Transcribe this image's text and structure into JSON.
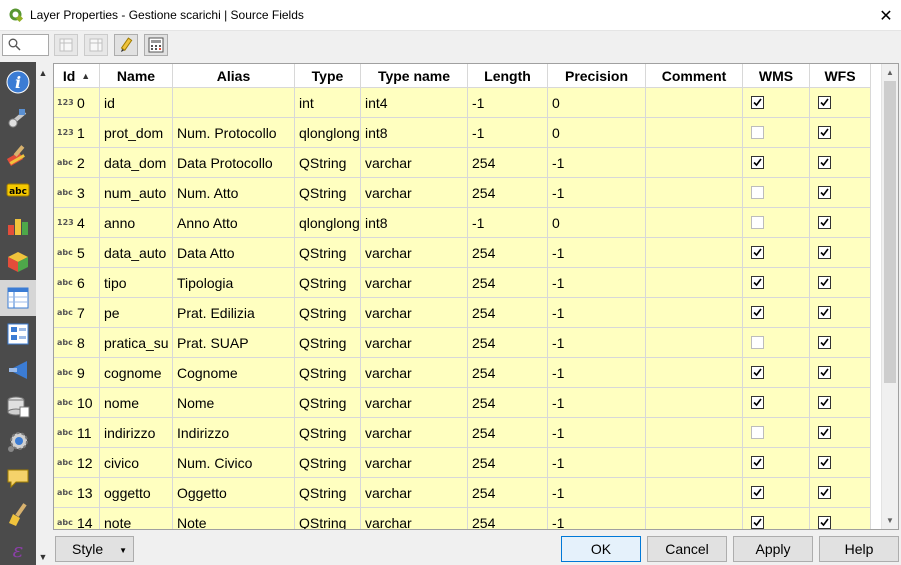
{
  "window": {
    "title": "Layer Properties - Gestione scarichi | Source Fields",
    "close_glyph": "✕"
  },
  "left_panel": {
    "search_placeholder": "",
    "nav_icons": [
      "information-icon",
      "source-icon",
      "style-icon",
      "labels-icon",
      "diagrams-icon",
      "3d-view-icon",
      "source-fields-icon",
      "attributes-form-icon",
      "joins-icon",
      "auxiliary-storage-icon",
      "actions-icon",
      "display-icon",
      "rendering-icon",
      "variables-icon"
    ],
    "active_item": "source-fields-icon"
  },
  "toolbar": {
    "buttons": [
      "new-field-icon",
      "delete-field-icon",
      "toggle-editing-icon",
      "field-calculator-icon"
    ]
  },
  "table": {
    "columns": [
      "Id",
      "Name",
      "Alias",
      "Type",
      "Type name",
      "Length",
      "Precision",
      "Comment",
      "WMS",
      "WFS"
    ],
    "sort_column": "Id",
    "sort_indicator": "▲",
    "rows": [
      {
        "type_icon": "123",
        "id": "0",
        "name": "id",
        "alias": "",
        "type": "int",
        "type_name": "int4",
        "length": "-1",
        "precision": "0",
        "comment": "",
        "wms": true,
        "wfs": true
      },
      {
        "type_icon": "123",
        "id": "1",
        "name": "prot_dom",
        "alias": "Num. Protocollo",
        "type": "qlonglong",
        "type_name": "int8",
        "length": "-1",
        "precision": "0",
        "comment": "",
        "wms": false,
        "wfs": true
      },
      {
        "type_icon": "abc",
        "id": "2",
        "name": "data_dom",
        "alias": "Data Protocollo",
        "type": "QString",
        "type_name": "varchar",
        "length": "254",
        "precision": "-1",
        "comment": "",
        "wms": true,
        "wfs": true
      },
      {
        "type_icon": "abc",
        "id": "3",
        "name": "num_auto",
        "alias": "Num. Atto",
        "type": "QString",
        "type_name": "varchar",
        "length": "254",
        "precision": "-1",
        "comment": "",
        "wms": false,
        "wfs": true
      },
      {
        "type_icon": "123",
        "id": "4",
        "name": "anno",
        "alias": "Anno Atto",
        "type": "qlonglong",
        "type_name": "int8",
        "length": "-1",
        "precision": "0",
        "comment": "",
        "wms": false,
        "wfs": true
      },
      {
        "type_icon": "abc",
        "id": "5",
        "name": "data_auto",
        "alias": "Data Atto",
        "type": "QString",
        "type_name": "varchar",
        "length": "254",
        "precision": "-1",
        "comment": "",
        "wms": true,
        "wfs": true
      },
      {
        "type_icon": "abc",
        "id": "6",
        "name": "tipo",
        "alias": "Tipologia",
        "type": "QString",
        "type_name": "varchar",
        "length": "254",
        "precision": "-1",
        "comment": "",
        "wms": true,
        "wfs": true
      },
      {
        "type_icon": "abc",
        "id": "7",
        "name": "pe",
        "alias": "Prat. Edilizia",
        "type": "QString",
        "type_name": "varchar",
        "length": "254",
        "precision": "-1",
        "comment": "",
        "wms": true,
        "wfs": true
      },
      {
        "type_icon": "abc",
        "id": "8",
        "name": "pratica_su",
        "alias": "Prat. SUAP",
        "type": "QString",
        "type_name": "varchar",
        "length": "254",
        "precision": "-1",
        "comment": "",
        "wms": false,
        "wfs": true
      },
      {
        "type_icon": "abc",
        "id": "9",
        "name": "cognome",
        "alias": "Cognome",
        "type": "QString",
        "type_name": "varchar",
        "length": "254",
        "precision": "-1",
        "comment": "",
        "wms": true,
        "wfs": true
      },
      {
        "type_icon": "abc",
        "id": "10",
        "name": "nome",
        "alias": "Nome",
        "type": "QString",
        "type_name": "varchar",
        "length": "254",
        "precision": "-1",
        "comment": "",
        "wms": true,
        "wfs": true
      },
      {
        "type_icon": "abc",
        "id": "11",
        "name": "indirizzo",
        "alias": "Indirizzo",
        "type": "QString",
        "type_name": "varchar",
        "length": "254",
        "precision": "-1",
        "comment": "",
        "wms": false,
        "wfs": true
      },
      {
        "type_icon": "abc",
        "id": "12",
        "name": "civico",
        "alias": "Num. Civico",
        "type": "QString",
        "type_name": "varchar",
        "length": "254",
        "precision": "-1",
        "comment": "",
        "wms": true,
        "wfs": true
      },
      {
        "type_icon": "abc",
        "id": "13",
        "name": "oggetto",
        "alias": "Oggetto",
        "type": "QString",
        "type_name": "varchar",
        "length": "254",
        "precision": "-1",
        "comment": "",
        "wms": true,
        "wfs": true
      },
      {
        "type_icon": "abc",
        "id": "14",
        "name": "note",
        "alias": "Note",
        "type": "QString",
        "type_name": "varchar",
        "length": "254",
        "precision": "-1",
        "comment": "",
        "wms": true,
        "wfs": true
      }
    ]
  },
  "buttons": {
    "style": "Style",
    "ok": "OK",
    "cancel": "Cancel",
    "apply": "Apply",
    "help": "Help"
  },
  "colors": {
    "editable_cell": "#ffffc0",
    "nav_background": "#4b4b4b",
    "default_button_border": "#0078d7"
  }
}
